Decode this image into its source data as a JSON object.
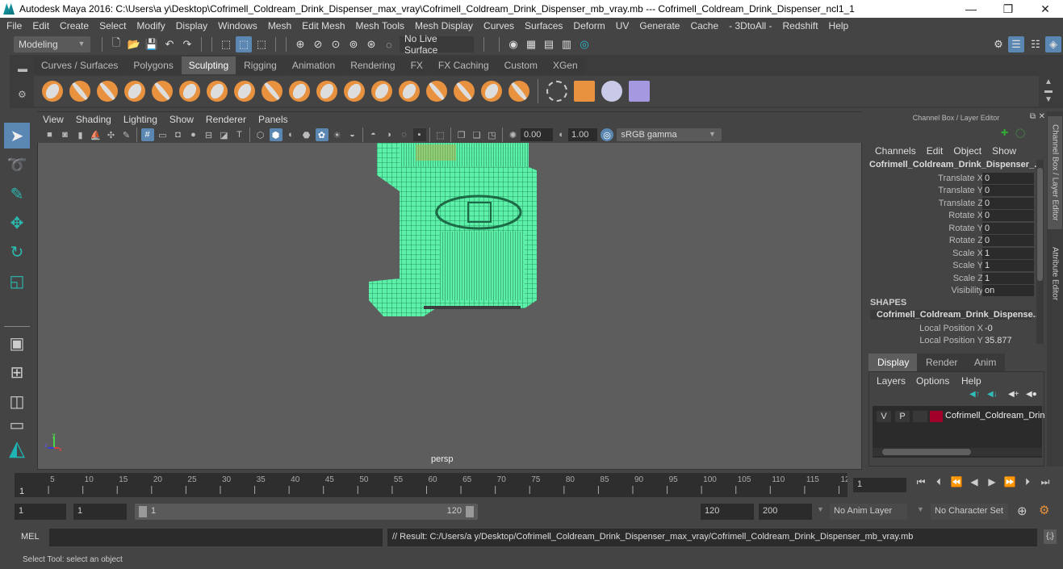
{
  "window": {
    "title": "Autodesk Maya 2016: C:\\Users\\a y\\Desktop\\Cofrimell_Coldream_Drink_Dispenser_max_vray\\Cofrimell_Coldream_Drink_Dispenser_mb_vray.mb   ---   Cofrimell_Coldream_Drink_Dispenser_ncl1_1",
    "minimize": "—",
    "maximize": "❐",
    "close": "✕"
  },
  "menubar": [
    "File",
    "Edit",
    "Create",
    "Select",
    "Modify",
    "Display",
    "Windows",
    "Mesh",
    "Edit Mesh",
    "Mesh Tools",
    "Mesh Display",
    "Curves",
    "Surfaces",
    "Deform",
    "UV",
    "Generate",
    "Cache",
    "- 3DtoAll -",
    "Redshift",
    "Help"
  ],
  "statusline": {
    "mode": "Modeling",
    "live_surface": "No Live Surface"
  },
  "shelf": {
    "tabs": [
      "Curves / Surfaces",
      "Polygons",
      "Sculpting",
      "Rigging",
      "Animation",
      "Rendering",
      "FX",
      "FX Caching",
      "Custom",
      "XGen"
    ],
    "active_tab": "Sculpting"
  },
  "viewport": {
    "menus": [
      "View",
      "Shading",
      "Lighting",
      "Show",
      "Renderer",
      "Panels"
    ],
    "exposure": "0.00",
    "gamma": "1.00",
    "color_space": "sRGB gamma",
    "camera_label": "persp",
    "axis": {
      "x": "x",
      "y": "y",
      "z": "z"
    },
    "wire_color": "#5cf0a8"
  },
  "channel_box": {
    "title": "Channel Box / Layer Editor",
    "menus": [
      "Channels",
      "Edit",
      "Object",
      "Show"
    ],
    "object": "Cofrimell_Coldream_Drink_Dispenser_...",
    "attributes": [
      {
        "label": "Translate X",
        "value": "0"
      },
      {
        "label": "Translate Y",
        "value": "0"
      },
      {
        "label": "Translate Z",
        "value": "0"
      },
      {
        "label": "Rotate X",
        "value": "0"
      },
      {
        "label": "Rotate Y",
        "value": "0"
      },
      {
        "label": "Rotate Z",
        "value": "0"
      },
      {
        "label": "Scale X",
        "value": "1"
      },
      {
        "label": "Scale Y",
        "value": "1"
      },
      {
        "label": "Scale Z",
        "value": "1"
      },
      {
        "label": "Visibility",
        "value": "on"
      }
    ],
    "shapes_header": "SHAPES",
    "shape_name": "Cofrimell_Coldream_Drink_Dispense...",
    "shape_attributes": [
      {
        "label": "Local Position X",
        "value": "-0"
      },
      {
        "label": "Local Position Y",
        "value": "35.877"
      }
    ]
  },
  "side_tabs": [
    "Channel Box / Layer Editor",
    "Attribute Editor"
  ],
  "layer_editor": {
    "tabs": [
      "Display",
      "Render",
      "Anim"
    ],
    "active_tab": "Display",
    "menus": [
      "Layers",
      "Options",
      "Help"
    ],
    "layer": {
      "v": "V",
      "p": "P",
      "name": "Cofrimell_Coldream_Drin",
      "color": "#a0002a"
    }
  },
  "timeline": {
    "ticks": [
      "5",
      "10",
      "15",
      "20",
      "25",
      "30",
      "35",
      "40",
      "45",
      "50",
      "55",
      "60",
      "65",
      "70",
      "75",
      "80",
      "85",
      "90",
      "95",
      "100",
      "105",
      "110",
      "115",
      "12"
    ],
    "current_frame_marker": "1",
    "current_frame": "1"
  },
  "range": {
    "start": "1",
    "playback_start": "1",
    "slider_start": "1",
    "slider_end": "120",
    "playback_end": "120",
    "end": "200",
    "anim_layer": "No Anim Layer",
    "character_set": "No Character Set"
  },
  "cmdline": {
    "label": "MEL",
    "input": "",
    "result": "// Result: C:/Users/a y/Desktop/Cofrimell_Coldream_Drink_Dispenser_max_vray/Cofrimell_Coldream_Drink_Dispenser_mb_vray.mb"
  },
  "helpline": "Select Tool: select an object"
}
